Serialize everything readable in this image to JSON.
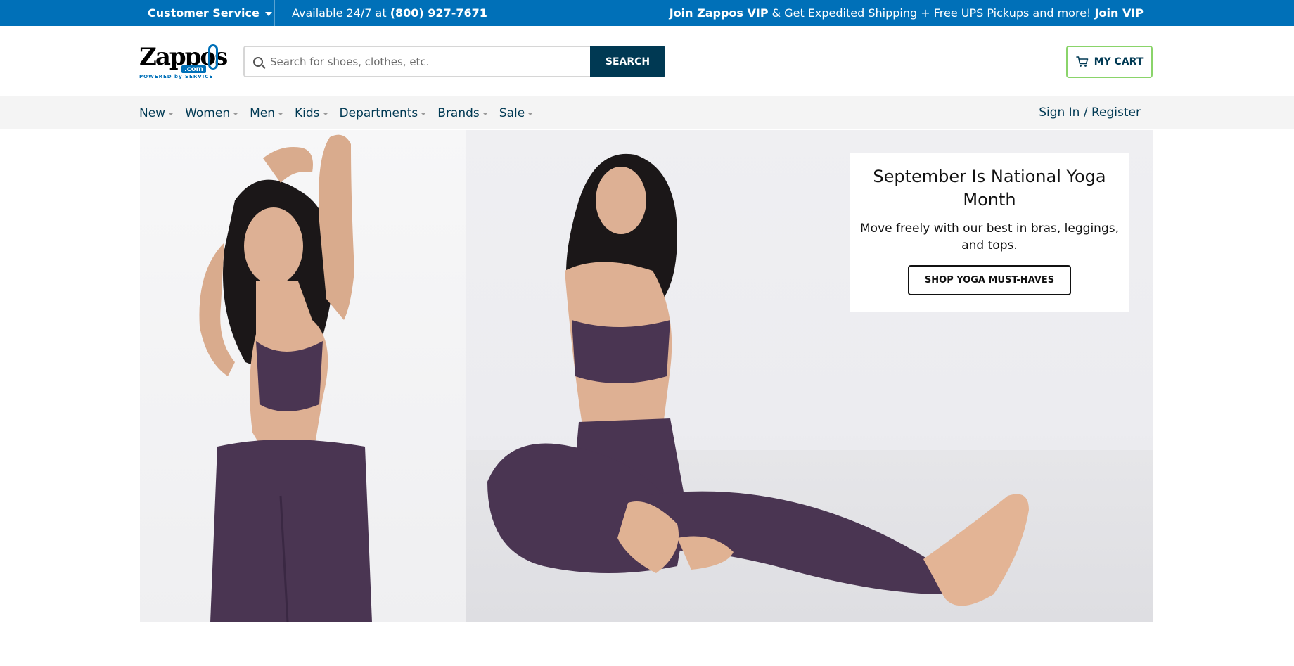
{
  "topbar": {
    "customer_service": "Customer Service",
    "available_prefix": "Available 24/7 at",
    "phone": "(800) 927-7671",
    "vip_bold": "Join Zappos VIP",
    "vip_text": "& Get Expedited Shipping + Free UPS Pickups and more!",
    "vip_link": "Join VIP"
  },
  "header": {
    "logo_word": "Zappos",
    "logo_dotcom": ".com",
    "logo_tagline": "POWERED by SERVICE",
    "search_placeholder": "Search for shoes, clothes, etc.",
    "search_button": "SEARCH",
    "cart_label": "MY CART"
  },
  "nav": {
    "items": [
      {
        "label": "New"
      },
      {
        "label": "Women"
      },
      {
        "label": "Men"
      },
      {
        "label": "Kids"
      },
      {
        "label": "Departments"
      },
      {
        "label": "Brands"
      },
      {
        "label": "Sale"
      }
    ],
    "signin": "Sign In / Register"
  },
  "hero": {
    "title": "September Is National Yoga Month",
    "subtitle": "Move freely with our best in bras, leggings, and tops.",
    "cta": "SHOP YOGA MUST-HAVES"
  },
  "colors": {
    "topbar_bg": "#0070b8",
    "primary_dark": "#003953",
    "cart_border": "#8ad46a",
    "nav_bg": "#f4f4f4",
    "apparel_purple": "#4a3552"
  }
}
